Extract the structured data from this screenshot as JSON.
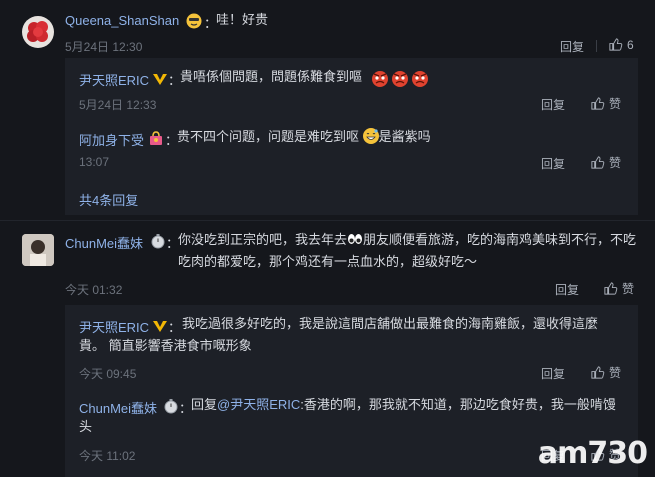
{
  "c1": {
    "user": "Queena_ShanShan",
    "text": "哇！好贵",
    "time": "5月24日 12:30",
    "reply_label": "回复",
    "likes": "6"
  },
  "r1": {
    "user": "尹天照ERIC",
    "text": "貴唔係個問題，問題係難食到嘔",
    "time": "5月24日 12:33",
    "reply_label": "回复",
    "like_label": "赞"
  },
  "r2": {
    "user": "阿加身下受",
    "text_a": "贵不四个问题，问题是难吃到呕",
    "text_b": "是酱紫吗",
    "time": "13:07",
    "reply_label": "回复",
    "like_label": "赞"
  },
  "more_replies": "共4条回复",
  "c2": {
    "user": "ChunMei蠢妹",
    "text_a": "你没吃到正宗的吧，我去年去",
    "text_b": "朋友顺便看旅游，吃的海南鸡美味到不行，不吃吃肉的都爱吃，那个鸡还有一点血水的，超级好吃～",
    "time": "今天 01:32",
    "reply_label": "回复",
    "like_label": "赞"
  },
  "r3": {
    "user": "尹天照ERIC",
    "text": "我吃過很多好吃的，我是說這間店舖做出最難食的海南雞飯，還收得這麼貴。 簡直影響香港食市嘅形象",
    "time": "今天 09:45",
    "reply_label": "回复",
    "like_label": "赞"
  },
  "r4": {
    "user": "ChunMei蠢妹",
    "reply_prefix": "回复",
    "mention": "@尹天照ERIC",
    "text": ":香港的啊，那我就不知道，那边吃食好贵，我一般啃馒头",
    "time": "今天 11:02",
    "reply_label": "回复",
    "like_label": "赞"
  },
  "watermark": {
    "brand": "am730"
  },
  "colors": {
    "link": "#8fb2e8",
    "background": "#15171c",
    "reply_bg": "#1d2027"
  }
}
